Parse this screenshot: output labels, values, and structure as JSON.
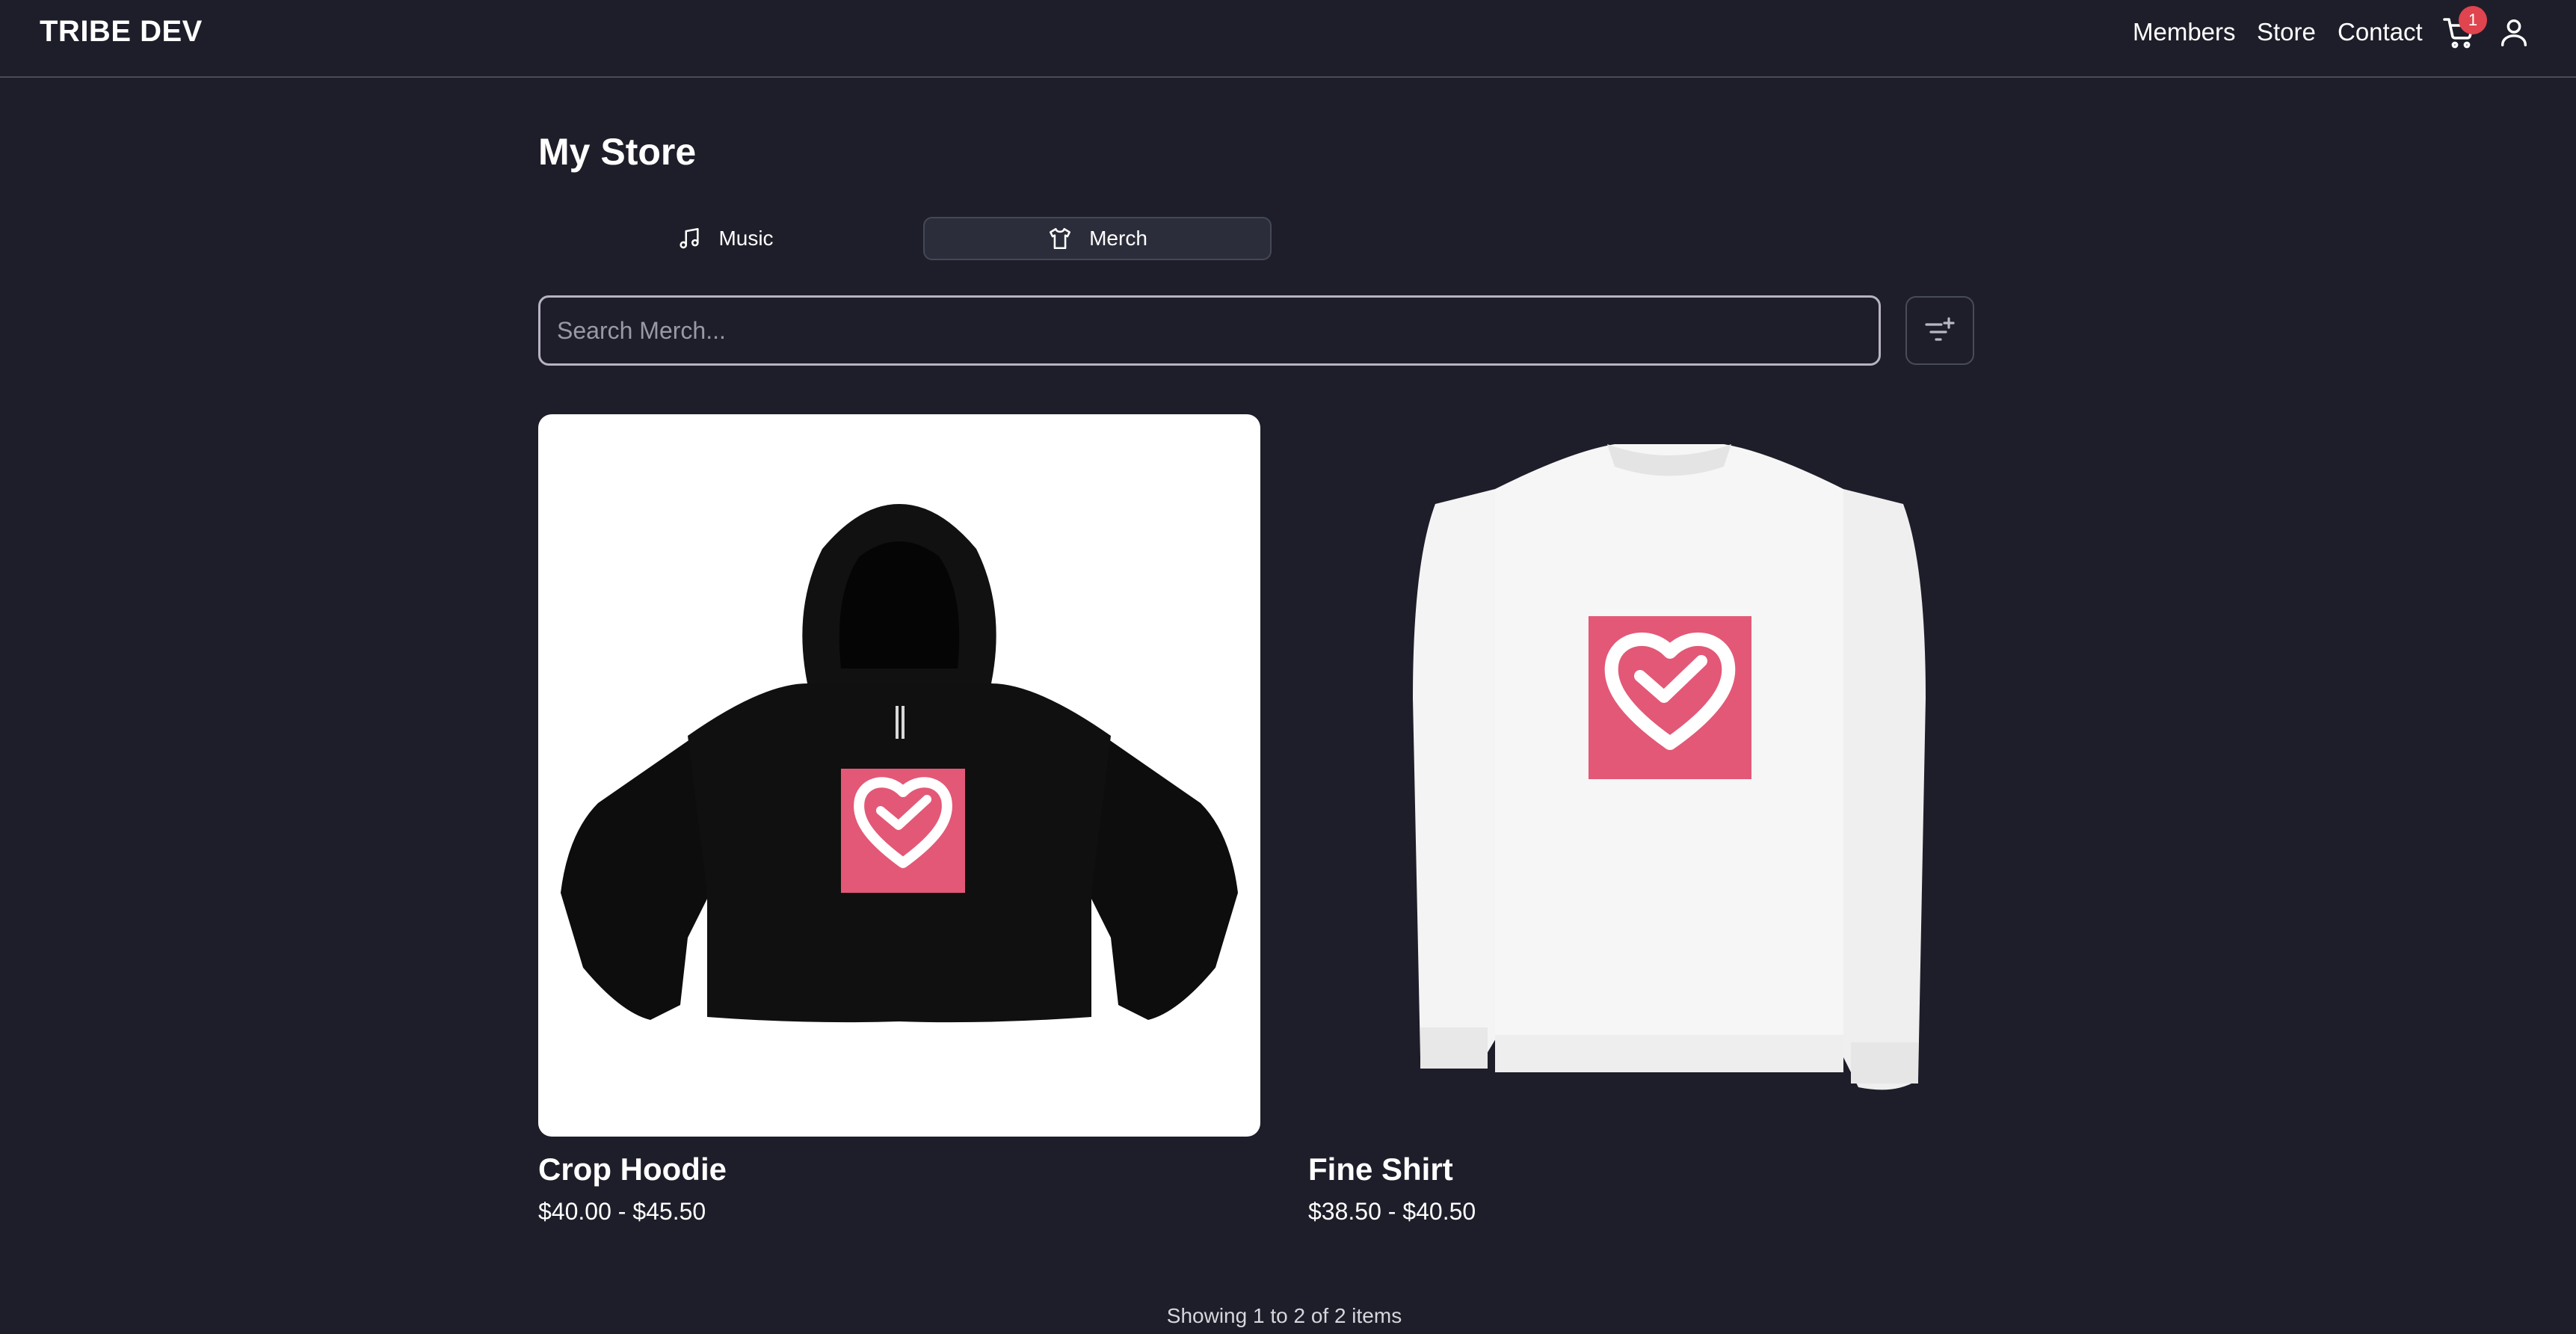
{
  "header": {
    "brand": "TRIBE DEV",
    "nav": [
      "Members",
      "Store",
      "Contact"
    ],
    "cart_count": "1",
    "cart_icon": "shopping-cart-icon",
    "user_icon": "user-icon"
  },
  "main": {
    "title": "My Store",
    "tabs": [
      {
        "label": "Music",
        "icon": "music-note-icon",
        "active": false
      },
      {
        "label": "Merch",
        "icon": "tshirt-icon",
        "active": true
      }
    ],
    "search": {
      "placeholder": "Search Merch...",
      "value": ""
    },
    "filter_icon": "filter-add-icon",
    "products": [
      {
        "name": "Crop Hoodie",
        "price": "$40.00 - $45.50",
        "image": "black crop hoodie with pink heart logo"
      },
      {
        "name": "Fine Shirt",
        "price": "$38.50 - $40.50",
        "image": "white sweatshirt with pink heart logo"
      }
    ],
    "pagination_text": "Showing 1 to 2 of 2 items"
  },
  "colors": {
    "background": "#1e1e2a",
    "badge": "#e0444e",
    "logo_pink": "#e35876"
  }
}
